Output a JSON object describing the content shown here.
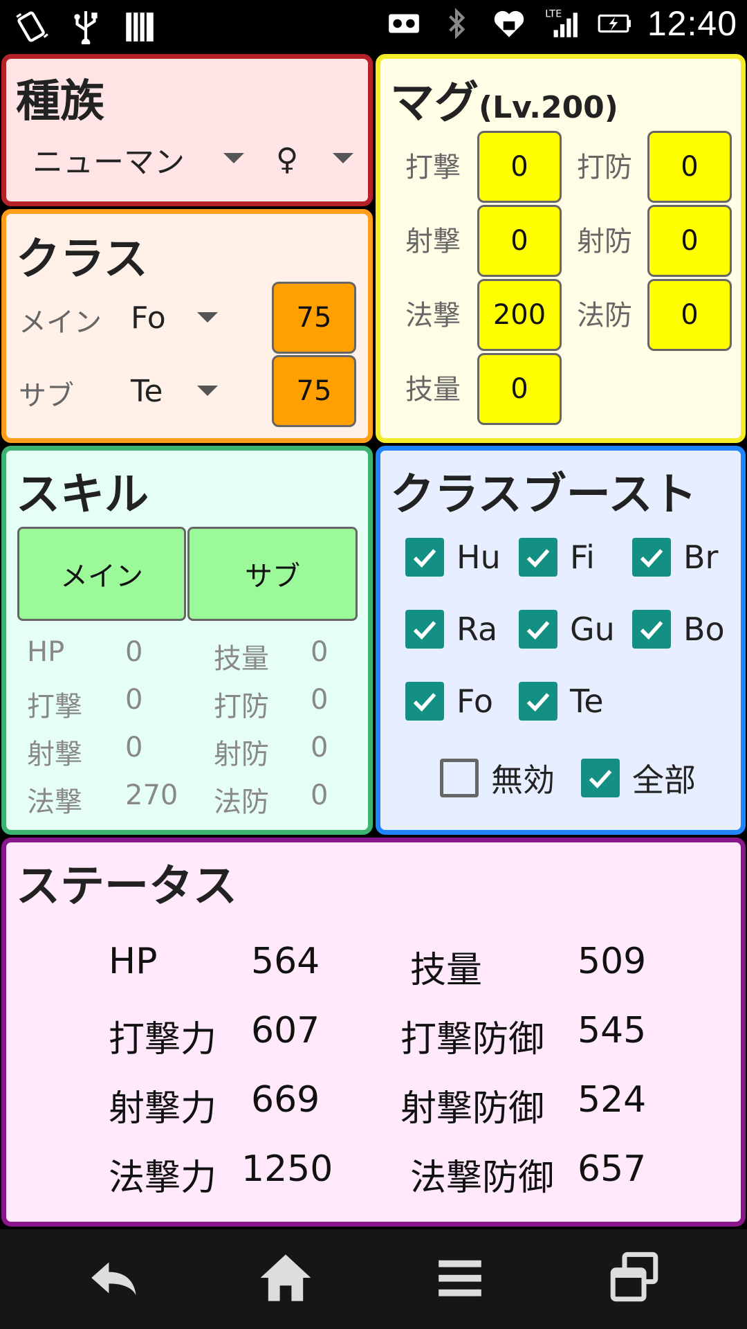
{
  "statusbar": {
    "time": "12:40",
    "left_icons": [
      "rotate-icon",
      "usb-icon",
      "storage-icon"
    ],
    "right_icons": [
      "voicemail-icon",
      "bluetooth-icon",
      "heart-icon",
      "lte-signal-icon",
      "battery-charging-icon"
    ],
    "lte_label": "LTE"
  },
  "race": {
    "title": "種族",
    "race_value": "ニューマン",
    "gender_value": "♀"
  },
  "klass": {
    "title": "クラス",
    "main_label": "メイン",
    "main_class": "Fo",
    "main_level": "75",
    "sub_label": "サブ",
    "sub_class": "Te",
    "sub_level": "75"
  },
  "mag": {
    "title": "マグ",
    "level": "(Lv.200)",
    "stats": [
      {
        "label": "打撃",
        "value": "0"
      },
      {
        "label": "打防",
        "value": "0"
      },
      {
        "label": "射撃",
        "value": "0"
      },
      {
        "label": "射防",
        "value": "0"
      },
      {
        "label": "法撃",
        "value": "200"
      },
      {
        "label": "法防",
        "value": "0"
      },
      {
        "label": "技量",
        "value": "0"
      }
    ]
  },
  "skill": {
    "title": "スキル",
    "main_button": "メイン",
    "sub_button": "サブ",
    "rows": [
      {
        "l1": "HP",
        "v1": "0",
        "l2": "技量",
        "v2": "0"
      },
      {
        "l1": "打撃",
        "v1": "0",
        "l2": "打防",
        "v2": "0"
      },
      {
        "l1": "射撃",
        "v1": "0",
        "l2": "射防",
        "v2": "0"
      },
      {
        "l1": "法撃",
        "v1": "270",
        "l2": "法防",
        "v2": "0"
      }
    ]
  },
  "boost": {
    "title": "クラスブースト",
    "classes": [
      {
        "label": "Hu",
        "checked": true
      },
      {
        "label": "Fi",
        "checked": true
      },
      {
        "label": "Br",
        "checked": true
      },
      {
        "label": "Ra",
        "checked": true
      },
      {
        "label": "Gu",
        "checked": true
      },
      {
        "label": "Bo",
        "checked": true
      },
      {
        "label": "Fo",
        "checked": true
      },
      {
        "label": "Te",
        "checked": true
      }
    ],
    "disable_label": "無効",
    "disable_checked": false,
    "all_label": "全部",
    "all_checked": true
  },
  "status": {
    "title": "ステータス",
    "rows": [
      {
        "l1": "HP",
        "v1": "564",
        "l2": "技量",
        "v2": "509"
      },
      {
        "l1": "打撃力",
        "v1": "607",
        "l2": "打撃防御",
        "v2": "545"
      },
      {
        "l1": "射撃力",
        "v1": "669",
        "l2": "射撃防御",
        "v2": "524"
      },
      {
        "l1": "法撃力",
        "v1": "1250",
        "l2": "法撃防御",
        "v2": "657"
      }
    ]
  },
  "colors": {
    "race_border": "#b52229",
    "class_border": "#ff9e1a",
    "mag_border": "#f2ec2b",
    "skill_border": "#3cb371",
    "boost_border": "#1f84ff",
    "status_border": "#8a168c",
    "checkbox": "#138f83"
  },
  "navbar": {
    "icons": [
      "back-icon",
      "home-icon",
      "menu-icon",
      "recent-apps-icon"
    ]
  }
}
